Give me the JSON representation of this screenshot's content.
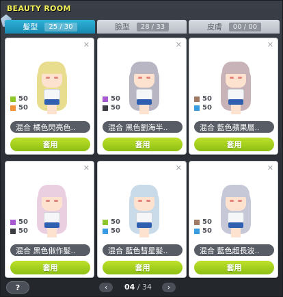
{
  "window": {
    "title": "BEAUTY ROOM"
  },
  "tabs": [
    {
      "label": "髮型",
      "count": "25 / 30",
      "active": true
    },
    {
      "label": "臉型",
      "count": "28 / 33",
      "active": false
    },
    {
      "label": "皮膚",
      "count": "00 / 00",
      "active": false
    }
  ],
  "cards": [
    {
      "name": "混合  橘色閃亮色..",
      "apply": "套用",
      "mix": [
        {
          "color": "#8fc72a",
          "pct": "50"
        },
        {
          "color": "#f1923d",
          "pct": "50"
        }
      ],
      "hair": "#e8dc8f"
    },
    {
      "name": "混合  黑色劉海半..",
      "apply": "套用",
      "mix": [
        {
          "color": "#a85ad2",
          "pct": "50"
        },
        {
          "color": "#3b3d42",
          "pct": "50"
        }
      ],
      "hair": "#b9b6c4"
    },
    {
      "name": "混合  藍色蘋果層..",
      "apply": "套用",
      "mix": [
        {
          "color": "#a07a64",
          "pct": "50"
        },
        {
          "color": "#3a9ce0",
          "pct": "50"
        }
      ],
      "hair": "#c8b4b8"
    },
    {
      "name": "混合  黑色俶作髮..",
      "apply": "套用",
      "mix": [
        {
          "color": "#a85ad2",
          "pct": "50"
        },
        {
          "color": "#3b3d42",
          "pct": "50"
        }
      ],
      "hair": "#e9cfe0"
    },
    {
      "name": "混合  藍色彗星髮..",
      "apply": "套用",
      "mix": [
        {
          "color": "#8fc72a",
          "pct": "50"
        },
        {
          "color": "#3a9ce0",
          "pct": "50"
        }
      ],
      "hair": "#c9dbe8"
    },
    {
      "name": "混合  藍色超長波..",
      "apply": "套用",
      "mix": [
        {
          "color": "#a07a64",
          "pct": "50"
        },
        {
          "color": "#3a9ce0",
          "pct": "50"
        }
      ],
      "hair": "#c6c8d8"
    }
  ],
  "footer": {
    "help": "?",
    "page_current": "04",
    "page_sep": "/",
    "page_total": "34",
    "prev": "‹",
    "next": "›"
  },
  "icons": {
    "close": "close-icon",
    "help": "help-icon",
    "prev": "chevron-left-icon",
    "next": "chevron-right-icon",
    "gem": "crystal-icon"
  },
  "colors": {
    "accent": "#1fa0c9",
    "apply": "#9ccd1a",
    "title": "#f2f05a"
  }
}
